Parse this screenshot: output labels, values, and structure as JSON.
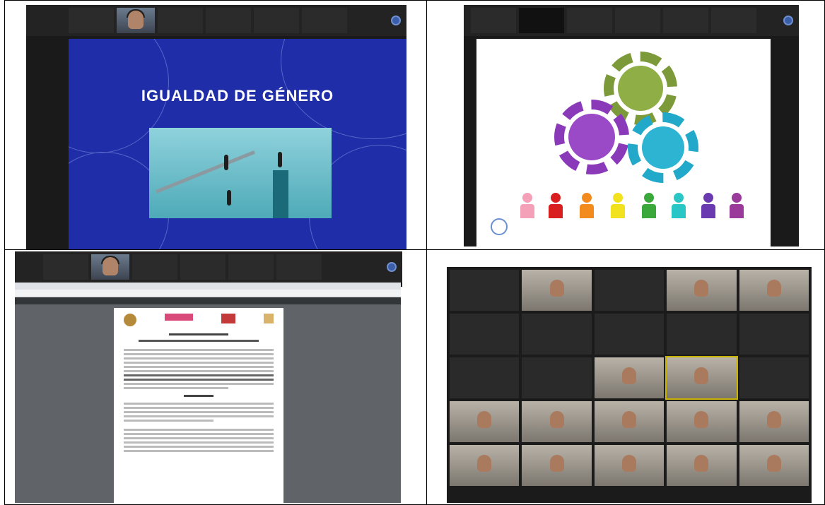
{
  "cells": {
    "c1": {
      "strip_labels": [
        "",
        "",
        "",
        "",
        "",
        ""
      ],
      "slide_title": "IGUALDAD DE GÉNERO",
      "slide_subtitle": ""
    },
    "c2": {
      "strip_labels": [
        "",
        "",
        "",
        "",
        "",
        ""
      ]
    },
    "c3": {
      "strip_labels": [
        "",
        "",
        "",
        "",
        ""
      ]
    },
    "c4": {
      "tiles": [
        {
          "label": "",
          "cam": false
        },
        {
          "label": "",
          "cam": true
        },
        {
          "label": "",
          "cam": false
        },
        {
          "label": "",
          "cam": true
        },
        {
          "label": "",
          "cam": true
        },
        {
          "label": "",
          "cam": false
        },
        {
          "label": "",
          "cam": false
        },
        {
          "label": "",
          "cam": false
        },
        {
          "label": "",
          "cam": false
        },
        {
          "label": "",
          "cam": false
        },
        {
          "label": "",
          "cam": false
        },
        {
          "label": "",
          "cam": false
        },
        {
          "label": "",
          "cam": true
        },
        {
          "label": "",
          "cam": true,
          "active": true
        },
        {
          "label": "",
          "cam": false
        },
        {
          "label": "",
          "cam": true
        },
        {
          "label": "",
          "cam": true
        },
        {
          "label": "",
          "cam": true
        },
        {
          "label": "",
          "cam": true
        },
        {
          "label": "",
          "cam": true
        },
        {
          "label": "",
          "cam": true
        },
        {
          "label": "",
          "cam": true
        },
        {
          "label": "",
          "cam": true
        },
        {
          "label": "",
          "cam": true
        },
        {
          "label": "",
          "cam": true
        }
      ]
    }
  },
  "colors": {
    "slide_blue": "#1f2ea8",
    "gear_purple": "#8a3ab9",
    "gear_green": "#7d9a3a",
    "gear_cyan": "#22a8c8",
    "figures": [
      "#f4a0b8",
      "#d81e1e",
      "#f28a1e",
      "#f2e21e",
      "#3aa83a",
      "#2ac6c6",
      "#6a3ab0",
      "#9a3a9a"
    ]
  }
}
